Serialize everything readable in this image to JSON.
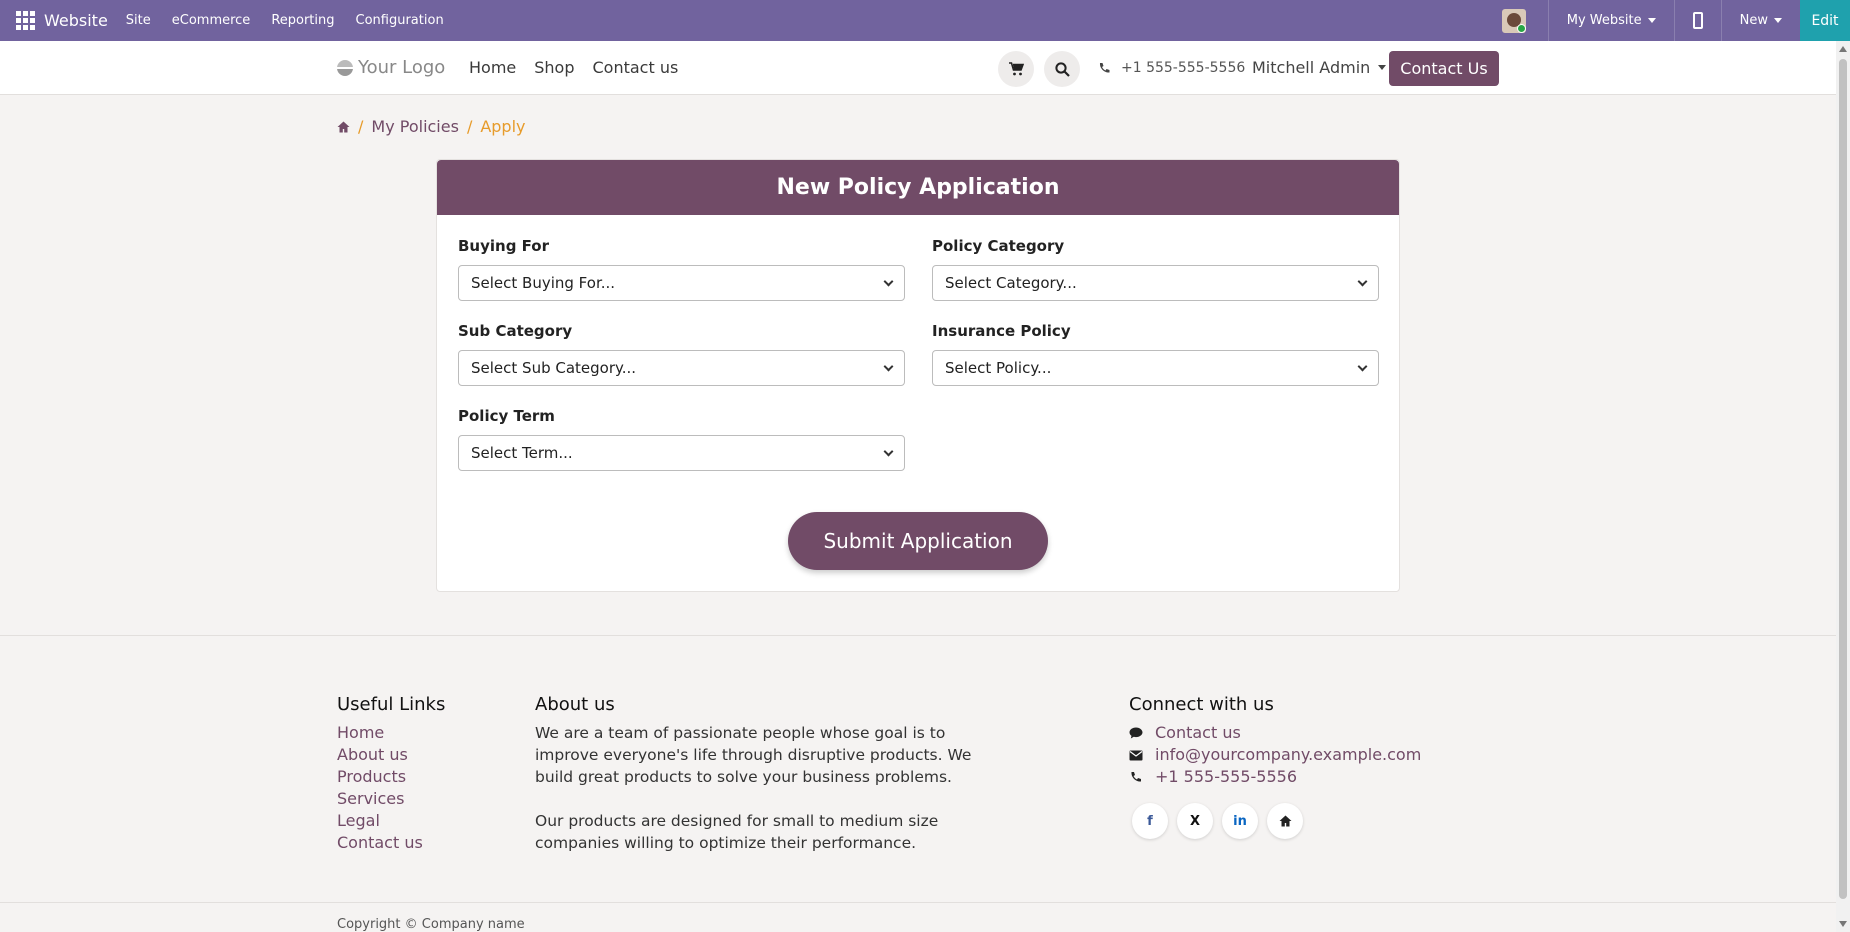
{
  "adminbar": {
    "brand": "Website",
    "menu": [
      "Site",
      "eCommerce",
      "Reporting",
      "Configuration"
    ],
    "site_selector": "My Website",
    "new_label": "New",
    "edit_label": "Edit"
  },
  "header": {
    "logo_text": "Your Logo",
    "nav": [
      "Home",
      "Shop",
      "Contact us"
    ],
    "phone": "+1 555-555-5556",
    "user": "Mitchell Admin",
    "contact_button": "Contact Us"
  },
  "breadcrumb": {
    "items": [
      "My Policies"
    ],
    "active": "Apply"
  },
  "form": {
    "title": "New Policy Application",
    "fields": [
      {
        "label": "Buying For",
        "placeholder": "Select Buying For..."
      },
      {
        "label": "Policy Category",
        "placeholder": "Select Category..."
      },
      {
        "label": "Sub Category",
        "placeholder": "Select Sub Category..."
      },
      {
        "label": "Insurance Policy",
        "placeholder": "Select Policy..."
      },
      {
        "label": "Policy Term",
        "placeholder": "Select Term..."
      }
    ],
    "submit_label": "Submit Application"
  },
  "footer": {
    "useful_links_title": "Useful Links",
    "useful_links": [
      "Home",
      "About us",
      "Products",
      "Services",
      "Legal",
      "Contact us"
    ],
    "about_title": "About us",
    "about_p1": "We are a team of passionate people whose goal is to improve everyone's life through disruptive products. We build great products to solve your business problems.",
    "about_p2": "Our products are designed for small to medium size companies willing to optimize their performance.",
    "connect_title": "Connect with us",
    "connect_contact": "Contact us",
    "connect_email": "info@yourcompany.example.com",
    "connect_phone": "+1 555-555-5556",
    "copyright": "Copyright © Company name"
  },
  "colors": {
    "admin_bar": "#71639e",
    "brand_primary": "#714b67",
    "edit_button": "#1fa1ad",
    "breadcrumb_active": "#e79b2a"
  }
}
